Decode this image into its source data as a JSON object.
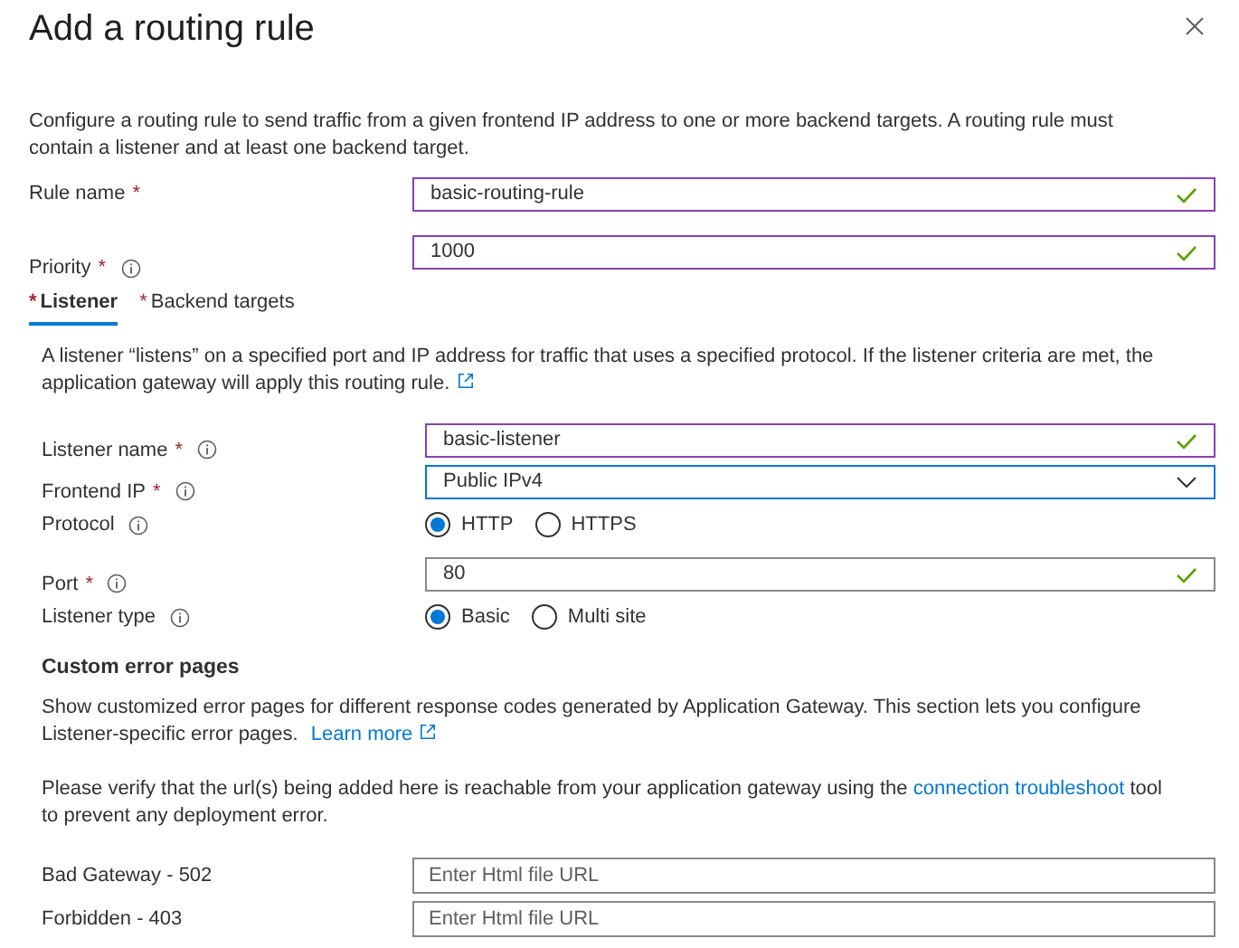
{
  "title": "Add a routing rule",
  "intro": "Configure a routing rule to send traffic from a given frontend IP address to one or more backend targets. A routing rule must contain a listener and at least one backend target.",
  "rule_fields": [
    {
      "kind": "text",
      "label": "Rule name",
      "required_mark": "*",
      "value": "basic-routing-rule",
      "valid": true,
      "dirty": true,
      "focused": false
    },
    {
      "kind": "text",
      "label": "Priority",
      "required_mark": "*",
      "info": true,
      "value": "1000",
      "valid": true,
      "dirty": true,
      "focused": false
    }
  ],
  "tabs": [
    {
      "label": "Listener",
      "required_mark": "*",
      "selected": true
    },
    {
      "label": "Backend targets",
      "required_mark": "*",
      "selected": false
    }
  ],
  "listener_intro": "A listener “listens” on a specified port and IP address for traffic that uses a specified protocol. If the listener criteria are met, the application gateway will apply this routing rule.",
  "listener_fields": [
    {
      "kind": "text",
      "label": "Listener name",
      "required_mark": "*",
      "info": true,
      "value": "basic-listener",
      "valid": true,
      "dirty": true,
      "focused": false
    },
    {
      "kind": "select",
      "label": "Frontend IP",
      "required_mark": "*",
      "info": true,
      "value": "Public IPv4",
      "valid": false,
      "focused": true
    },
    {
      "kind": "radio",
      "label": "Protocol",
      "info": true,
      "options": [
        {
          "label": "HTTP",
          "selected": true
        },
        {
          "label": "HTTPS",
          "selected": false
        }
      ]
    },
    {
      "kind": "text",
      "label": "Port",
      "required_mark": "*",
      "info": true,
      "value": "80",
      "valid": true,
      "dirty": false,
      "focused": false
    },
    {
      "kind": "radio",
      "label": "Listener type",
      "info": true,
      "options": [
        {
          "label": "Basic",
          "selected": true
        },
        {
          "label": "Multi site",
          "selected": false
        }
      ]
    }
  ],
  "error_pages": {
    "heading": "Custom error pages",
    "description": "Show customized error pages for different response codes generated by Application Gateway. This section lets you configure Listener-specific error pages.",
    "learn_more": "Learn more",
    "verify_before": "Please verify that the url(s) being added here is reachable from your application gateway using the",
    "verify_link": "connection troubleshoot",
    "verify_after": "tool to prevent any deployment error.",
    "fields": [
      {
        "label": "Bad Gateway - 502",
        "placeholder": "Enter Html file URL"
      },
      {
        "label": "Forbidden - 403",
        "placeholder": "Enter Html file URL"
      }
    ]
  }
}
